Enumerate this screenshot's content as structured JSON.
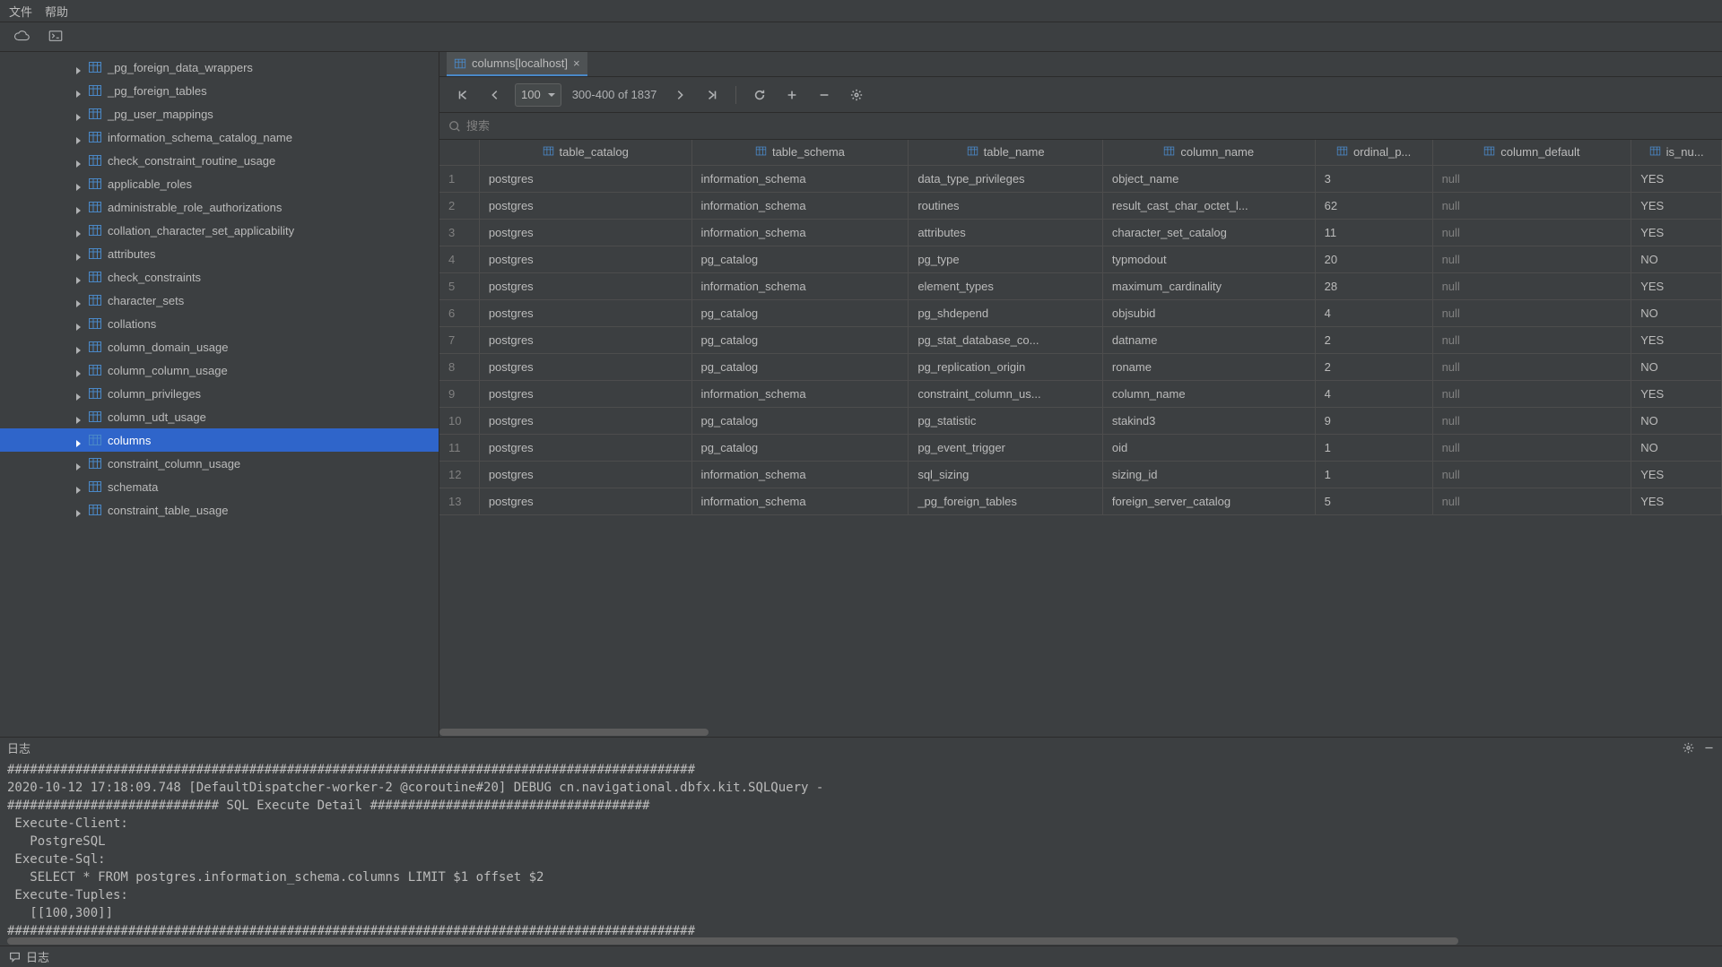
{
  "menu": {
    "file": "文件",
    "help": "帮助"
  },
  "sidebar": {
    "items": [
      "_pg_foreign_data_wrappers",
      "_pg_foreign_tables",
      "_pg_user_mappings",
      "information_schema_catalog_name",
      "check_constraint_routine_usage",
      "applicable_roles",
      "administrable_role_authorizations",
      "collation_character_set_applicability",
      "attributes",
      "check_constraints",
      "character_sets",
      "collations",
      "column_domain_usage",
      "column_column_usage",
      "column_privileges",
      "column_udt_usage",
      "columns",
      "constraint_column_usage",
      "schemata",
      "constraint_table_usage"
    ],
    "selected_index": 16
  },
  "tab": {
    "label": "columns[localhost]"
  },
  "pager": {
    "page_size": "100",
    "range": "300-400 of 1837"
  },
  "search_placeholder": "搜索",
  "columns": [
    "table_catalog",
    "table_schema",
    "table_name",
    "column_name",
    "ordinal_p...",
    "column_default",
    "is_nu..."
  ],
  "rows": [
    {
      "n": 1,
      "table_catalog": "postgres",
      "table_schema": "information_schema",
      "table_name": "data_type_privileges",
      "column_name": "object_name",
      "ordinal": "3",
      "default": null,
      "is_null": "YES"
    },
    {
      "n": 2,
      "table_catalog": "postgres",
      "table_schema": "information_schema",
      "table_name": "routines",
      "column_name": "result_cast_char_octet_l...",
      "ordinal": "62",
      "default": null,
      "is_null": "YES"
    },
    {
      "n": 3,
      "table_catalog": "postgres",
      "table_schema": "information_schema",
      "table_name": "attributes",
      "column_name": "character_set_catalog",
      "ordinal": "11",
      "default": null,
      "is_null": "YES"
    },
    {
      "n": 4,
      "table_catalog": "postgres",
      "table_schema": "pg_catalog",
      "table_name": "pg_type",
      "column_name": "typmodout",
      "ordinal": "20",
      "default": null,
      "is_null": "NO"
    },
    {
      "n": 5,
      "table_catalog": "postgres",
      "table_schema": "information_schema",
      "table_name": "element_types",
      "column_name": "maximum_cardinality",
      "ordinal": "28",
      "default": null,
      "is_null": "YES"
    },
    {
      "n": 6,
      "table_catalog": "postgres",
      "table_schema": "pg_catalog",
      "table_name": "pg_shdepend",
      "column_name": "objsubid",
      "ordinal": "4",
      "default": null,
      "is_null": "NO"
    },
    {
      "n": 7,
      "table_catalog": "postgres",
      "table_schema": "pg_catalog",
      "table_name": "pg_stat_database_co...",
      "column_name": "datname",
      "ordinal": "2",
      "default": null,
      "is_null": "YES"
    },
    {
      "n": 8,
      "table_catalog": "postgres",
      "table_schema": "pg_catalog",
      "table_name": "pg_replication_origin",
      "column_name": "roname",
      "ordinal": "2",
      "default": null,
      "is_null": "NO"
    },
    {
      "n": 9,
      "table_catalog": "postgres",
      "table_schema": "information_schema",
      "table_name": "constraint_column_us...",
      "column_name": "column_name",
      "ordinal": "4",
      "default": null,
      "is_null": "YES"
    },
    {
      "n": 10,
      "table_catalog": "postgres",
      "table_schema": "pg_catalog",
      "table_name": "pg_statistic",
      "column_name": "stakind3",
      "ordinal": "9",
      "default": null,
      "is_null": "NO"
    },
    {
      "n": 11,
      "table_catalog": "postgres",
      "table_schema": "pg_catalog",
      "table_name": "pg_event_trigger",
      "column_name": "oid",
      "ordinal": "1",
      "default": null,
      "is_null": "NO"
    },
    {
      "n": 12,
      "table_catalog": "postgres",
      "table_schema": "information_schema",
      "table_name": "sql_sizing",
      "column_name": "sizing_id",
      "ordinal": "1",
      "default": null,
      "is_null": "YES"
    },
    {
      "n": 13,
      "table_catalog": "postgres",
      "table_schema": "information_schema",
      "table_name": "_pg_foreign_tables",
      "column_name": "foreign_server_catalog",
      "ordinal": "5",
      "default": null,
      "is_null": "YES"
    }
  ],
  "log": {
    "title": "日志",
    "lines": [
      "###########################################################################################",
      "2020-10-12 17:18:09.748 [DefaultDispatcher-worker-2 @coroutine#20] DEBUG cn.navigational.dbfx.kit.SQLQuery - ",
      "############################ SQL Execute Detail #####################################",
      " Execute-Client:",
      "   PostgreSQL",
      " Execute-Sql:",
      "   SELECT * FROM postgres.information_schema.columns LIMIT $1 offset $2",
      " Execute-Tuples:",
      "   [[100,300]]",
      "###########################################################################################"
    ]
  },
  "status": {
    "label": "日志"
  }
}
